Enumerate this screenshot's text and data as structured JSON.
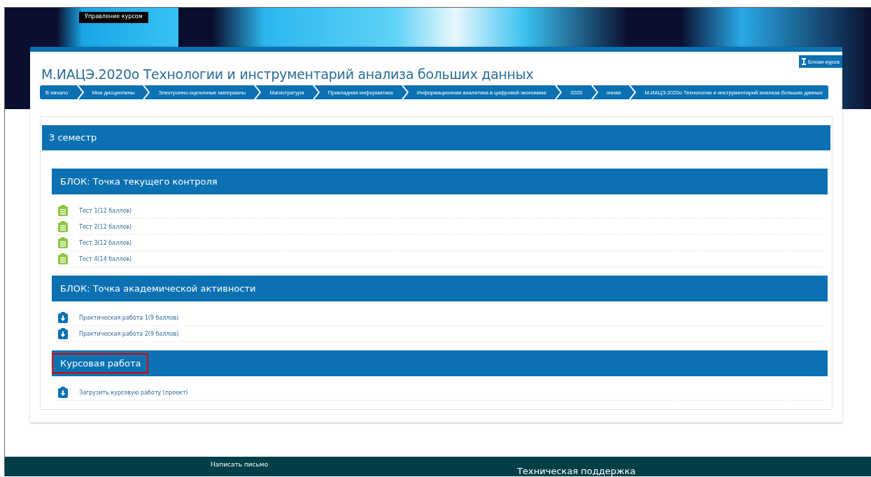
{
  "banner": {
    "menu_label": "Управление курсом"
  },
  "course": {
    "title": "М.ИАЦЭ.2020о Технологии и инструментарий анализа больших данных",
    "blocks_button": "Блоки курса",
    "breadcrumbs": [
      "В начало",
      "Мои дисциплины",
      "Электронно-оценочные материалы",
      "Магистратура",
      "Прикладная информатика",
      "Информационная аналитика в цифровой экономике",
      "2020",
      "очная",
      "М.ИАЦЭ.2020о Технологии и инструментарий анализа больших данных"
    ]
  },
  "semester": {
    "title": "3 семестр",
    "blocks": [
      {
        "title": "БЛОК: Точка текущего контроля",
        "highlighted": false,
        "items": [
          {
            "kind": "quiz",
            "label": "Тест 1(12 баллов)"
          },
          {
            "kind": "quiz",
            "label": "Тест 2(12 баллов)"
          },
          {
            "kind": "quiz",
            "label": "Тест 3(12 баллов)"
          },
          {
            "kind": "quiz",
            "label": "Тест 4(14 баллов)"
          }
        ]
      },
      {
        "title": "БЛОК: Точка академической активности",
        "highlighted": false,
        "items": [
          {
            "kind": "assignment",
            "label": "Практическая работа 1(9 баллов)"
          },
          {
            "kind": "assignment",
            "label": "Практическая работа 2(9 баллов)"
          }
        ]
      },
      {
        "title": "Курсовая работа",
        "highlighted": true,
        "items": [
          {
            "kind": "assignment",
            "label": "Загрузить курсовую работу (проект)"
          }
        ]
      }
    ]
  },
  "footer": {
    "left_link": "Написать письмо",
    "right_title": "Техническая поддержка"
  }
}
